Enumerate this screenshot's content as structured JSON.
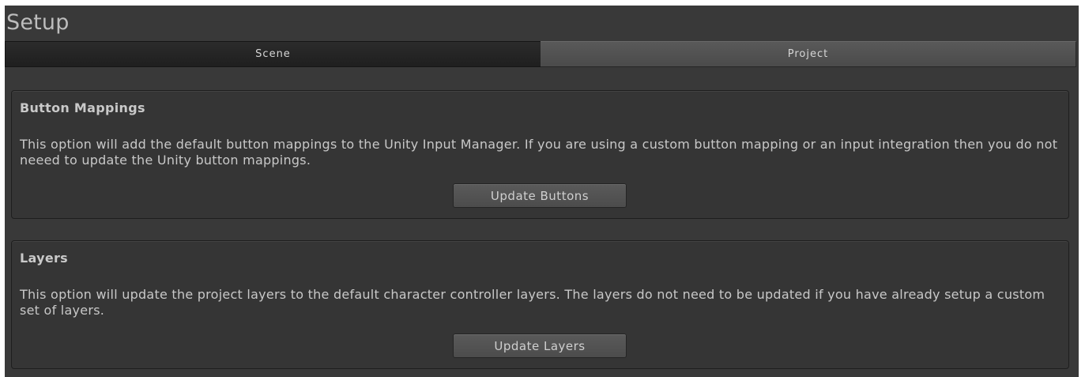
{
  "window": {
    "title": "Setup"
  },
  "tabs": [
    {
      "label": "Scene",
      "selected": true
    },
    {
      "label": "Project",
      "selected": false
    }
  ],
  "panels": {
    "button_mappings": {
      "title": "Button Mappings",
      "description": "This option will add the default button mappings to the Unity Input Manager. If you are using a custom button mapping or an input integration then you do not neeed to update the Unity button mappings.",
      "button_label": "Update Buttons"
    },
    "layers": {
      "title": "Layers",
      "description": "This option will update the project layers to the default character controller layers. The layers do not need to be updated if you have already setup a custom set of layers.",
      "button_label": "Update Layers"
    }
  },
  "colors": {
    "window_background": "#393939",
    "panel_background": "#353535",
    "selected_tab": "#262626",
    "unselected_tab": "#535353",
    "text": "#c8c8c8"
  }
}
